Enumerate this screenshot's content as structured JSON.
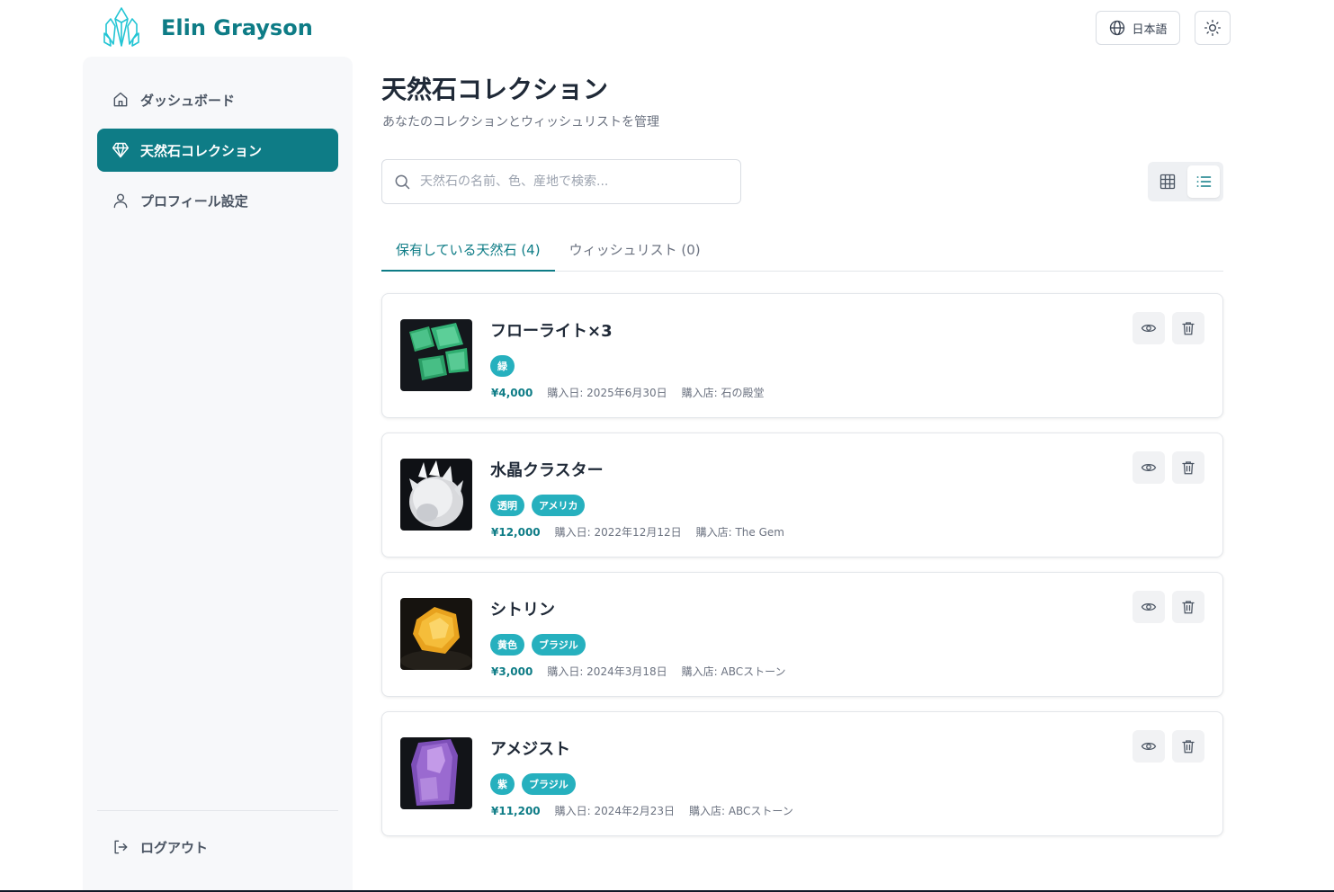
{
  "brand": {
    "name": "Elin Grayson",
    "icon": "crystal-logo-icon",
    "color": "#0e7c86"
  },
  "header": {
    "language_label": "日本語",
    "language_icon": "globe-icon",
    "theme_icon": "sun-icon"
  },
  "sidebar": {
    "items": [
      {
        "label": "ダッシュボード",
        "icon": "home-icon",
        "active": false
      },
      {
        "label": "天然石コレクション",
        "icon": "gem-icon",
        "active": true
      },
      {
        "label": "プロフィール設定",
        "icon": "user-icon",
        "active": false
      }
    ],
    "logout_label": "ログアウト"
  },
  "main": {
    "title": "天然石コレクション",
    "subtitle": "あなたのコレクションとウィッシュリストを管理",
    "search_placeholder": "天然石の名前、色、産地で検索...",
    "view_modes": [
      "grid-icon",
      "list-icon"
    ],
    "active_view": "list",
    "tabs": [
      {
        "label": "保有している天然石 (4)",
        "active": true
      },
      {
        "label": "ウィッシュリスト (0)",
        "active": false
      }
    ],
    "stones": [
      {
        "name": "フローライト×3",
        "tags": [
          "緑"
        ],
        "price": "¥4,000",
        "purchase_date": "購入日: 2025年6月30日",
        "shop": "購入店: 石の殿堂",
        "image": "fluorite"
      },
      {
        "name": "水晶クラスター",
        "tags": [
          "透明",
          "アメリカ"
        ],
        "price": "¥12,000",
        "purchase_date": "購入日: 2022年12月12日",
        "shop": "購入店: The Gem",
        "image": "quartz"
      },
      {
        "name": "シトリン",
        "tags": [
          "黄色",
          "ブラジル"
        ],
        "price": "¥3,000",
        "purchase_date": "購入日: 2024年3月18日",
        "shop": "購入店: ABCストーン",
        "image": "citrine"
      },
      {
        "name": "アメジスト",
        "tags": [
          "紫",
          "ブラジル"
        ],
        "price": "¥11,200",
        "purchase_date": "購入日: 2024年2月23日",
        "shop": "購入店: ABCストーン",
        "image": "amethyst"
      }
    ]
  },
  "colors": {
    "accent": "#0e7c86",
    "tag": "#26b0be"
  }
}
